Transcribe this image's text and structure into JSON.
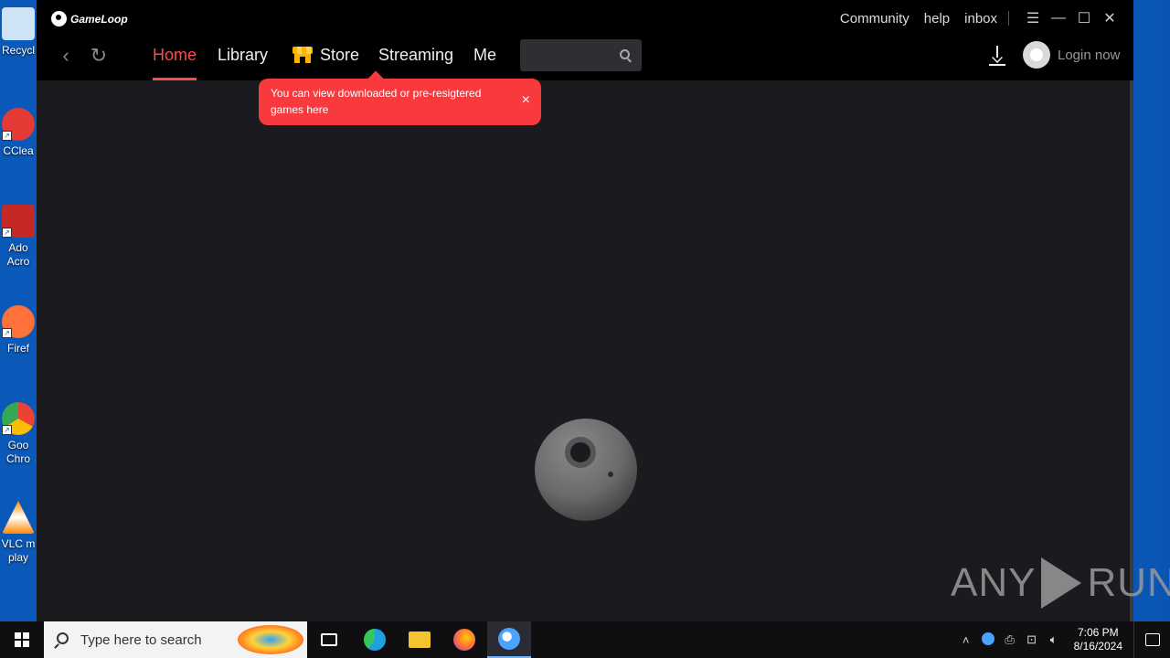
{
  "desktop": {
    "icons": [
      {
        "label": "Recycl",
        "color": "#cfe3f7"
      },
      {
        "label": "CClea",
        "color": "#e53935"
      },
      {
        "label": "Ado Acro",
        "color": "#c62828"
      },
      {
        "label": "Firef",
        "color": "#ff7139"
      },
      {
        "label": "Goo Chro",
        "color": "#34a853"
      },
      {
        "label": "VLC m play",
        "color": "#ff8800"
      }
    ]
  },
  "app": {
    "logo_text": "GameLoop",
    "top_links": [
      "Community",
      "help",
      "inbox"
    ],
    "window_controls": {
      "menu": "☰",
      "minimize": "—",
      "maximize": "☐",
      "close": "✕"
    },
    "nav": {
      "back": "‹",
      "refresh": "↻",
      "tabs": [
        {
          "label": "Home",
          "active": true
        },
        {
          "label": "Library",
          "active": false
        },
        {
          "label": "Store",
          "active": false
        },
        {
          "label": "Streaming",
          "active": false
        },
        {
          "label": "Me",
          "active": false
        }
      ]
    },
    "search": {
      "placeholder": ""
    },
    "login_label": "Login now",
    "tooltip": {
      "text": "You can view downloaded or pre-resigtered games here",
      "close": "×"
    },
    "accent_color": "#ff4a4a"
  },
  "watermark": {
    "left": "ANY",
    "right": "RUN"
  },
  "taskbar": {
    "search_placeholder": "Type here to search",
    "apps": [
      {
        "name": "task-view-icon",
        "color": "#ffffff"
      },
      {
        "name": "edge-icon",
        "color": "#1fa0e0"
      },
      {
        "name": "file-explorer-icon",
        "color": "#f4c430"
      },
      {
        "name": "firefox-icon",
        "color": "#ff7139"
      },
      {
        "name": "gameloop-icon",
        "color": "#4aa3ff"
      }
    ],
    "time": "7:06 PM",
    "date": "8/16/2024"
  }
}
